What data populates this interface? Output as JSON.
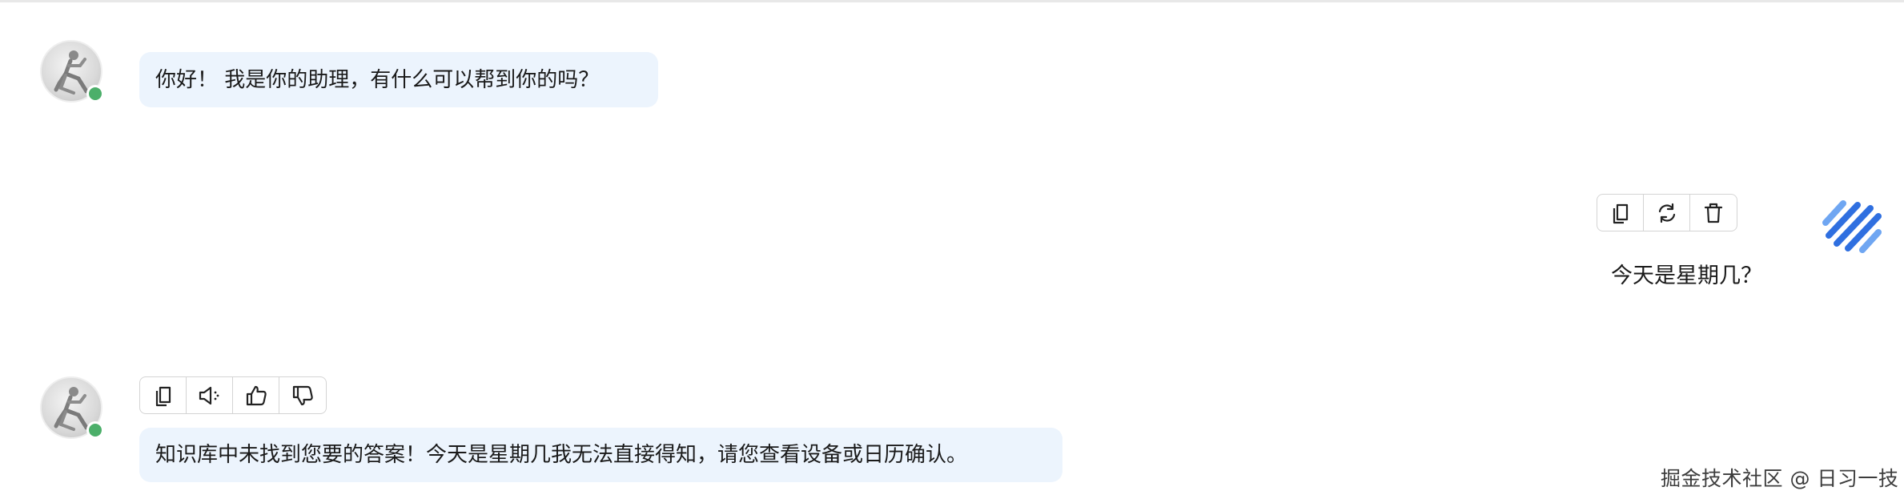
{
  "messages": [
    {
      "role": "assistant",
      "avatar_icon": "mannequin-avatar-icon",
      "status": "online",
      "text": "你好！ 我是你的助理，有什么可以帮到你的吗？"
    },
    {
      "role": "user",
      "avatar_icon": "striped-logo-icon",
      "actions": [
        "copy-icon",
        "refresh-icon",
        "trash-icon"
      ],
      "text": "今天是星期几？"
    },
    {
      "role": "assistant",
      "avatar_icon": "mannequin-avatar-icon",
      "status": "online",
      "actions": [
        "copy-icon",
        "speaker-icon",
        "thumbs-up-icon",
        "thumbs-down-icon"
      ],
      "text": "知识库中未找到您要的答案！今天是星期几我无法直接得知，请您查看设备或日历确认。"
    }
  ],
  "watermark": "掘金技术社区 @ 日习一技",
  "colors": {
    "assistant_bubble": "#ecf4fd",
    "online_dot": "#4caf6a",
    "logo_blue": "#2f6fe0",
    "logo_light_blue": "#6fa6f2",
    "toolbar_border": "#d4d4d4"
  }
}
